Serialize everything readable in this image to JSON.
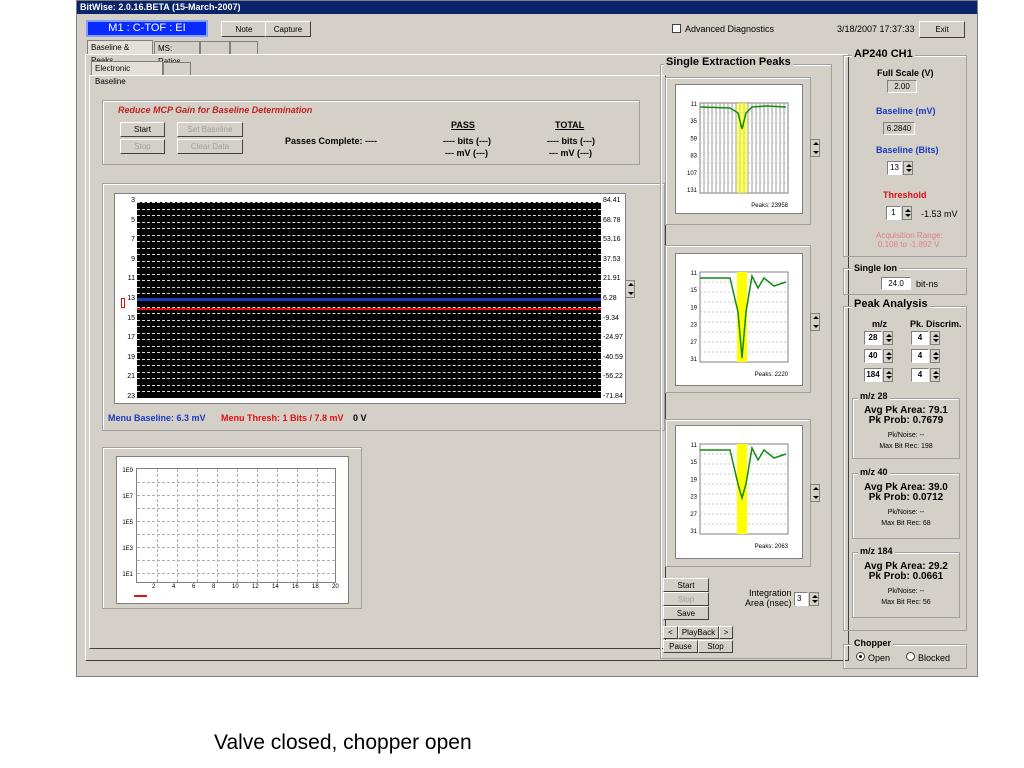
{
  "window_title": "BitWise: 2.0.16.BETA (15-March-2007)",
  "mode_label": "M1 : C-TOF : EI",
  "toolbar": {
    "note": "Note",
    "capture": "Capture",
    "advanced_diagnostics": "Advanced Diagnostics",
    "datetime": "3/18/2007 17:37:33",
    "exit": "Exit"
  },
  "tabs": [
    "Baseline & Peaks",
    "MS: Ratios",
    "",
    ""
  ],
  "subtabs": [
    "Electronic Baseline",
    ""
  ],
  "baseline": {
    "warning": "Reduce MCP Gain for Baseline Determination",
    "start": "Start",
    "set_baseline": "Set Baseline",
    "stop": "Stop",
    "clear_data": "Clear Data",
    "passes_complete": "Passes Complete: ----",
    "pass_header": "PASS",
    "total_header": "TOTAL",
    "pass_bits": "---- bits (---)",
    "pass_mv": "--- mV (---)",
    "total_bits": "---- bits (---)",
    "total_mv": "--- mV (---)"
  },
  "main_chart": {
    "left_ticks": [
      "3",
      "5",
      "7",
      "9",
      "11",
      "13",
      "15",
      "17",
      "19",
      "21",
      "23"
    ],
    "right_ticks": [
      "84.41",
      "68.78",
      "53.16",
      "37.53",
      "21.91",
      "6.28",
      "-9.34",
      "-24.97",
      "-40.59",
      "-56.22",
      "-71.84"
    ],
    "menu_baseline": "Menu Baseline: 6.3 mV",
    "menu_thresh": "Menu Thresh: 1 Bits / 7.8 mV",
    "zero_v": "0 V",
    "colors": {
      "baseline": "#1a3bc0",
      "threshold": "#e01010"
    }
  },
  "hist_chart": {
    "y_ticks": [
      "1E9",
      "1E7",
      "1E5",
      "1E3",
      "1E1"
    ],
    "x_ticks": [
      "2",
      "4",
      "6",
      "8",
      "10",
      "12",
      "14",
      "16",
      "18",
      "20"
    ]
  },
  "peaks": {
    "title": "Single Extraction Peaks",
    "panels": [
      {
        "y_ticks": [
          "11",
          "35",
          "59",
          "83",
          "107",
          "131"
        ],
        "label": "Peaks: 23958"
      },
      {
        "y_ticks": [
          "11",
          "15",
          "19",
          "23",
          "27",
          "31"
        ],
        "label": "Peaks: 2220"
      },
      {
        "y_ticks": [
          "11",
          "15",
          "19",
          "23",
          "27",
          "31"
        ],
        "label": "Peaks: 2063"
      }
    ],
    "start": "Start",
    "stop": "Stop",
    "save": "Save",
    "prev": "<",
    "playback": "PlayBack",
    "next": ">",
    "pause": "Pause",
    "stop2": "Stop",
    "integration_label_1": "Integration",
    "integration_label_2": "Area (nsec)",
    "integration_value": "3"
  },
  "ap240": {
    "title": "AP240 CH1",
    "full_scale_label": "Full Scale (V)",
    "full_scale_value": "2.00",
    "baseline_mv_label": "Baseline (mV)",
    "baseline_mv_value": "6.2840",
    "baseline_bits_label": "Baseline (Bits)",
    "baseline_bits_value": "13",
    "threshold_label": "Threshold",
    "threshold_value": "1",
    "threshold_mv": "-1.53 mV",
    "acq_range_1": "Acquisition Range:",
    "acq_range_2": "0.108 to -1.892 V"
  },
  "single_ion": {
    "title": "Single Ion",
    "value": "24.0",
    "unit": "bit-ns"
  },
  "peak_analysis": {
    "title": "Peak Analysis",
    "mz_header": "m/z",
    "discrim_header": "Pk. Discrim.",
    "rows": [
      {
        "mz": "28",
        "disc": "4"
      },
      {
        "mz": "40",
        "disc": "4"
      },
      {
        "mz": "184",
        "disc": "4"
      }
    ],
    "groups": [
      {
        "title": "m/z 28",
        "area": "Avg Pk Area: 79.1",
        "prob": "Pk Prob: 0.7679",
        "noise": "Pk/Noise: --",
        "maxbit": "Max Bit Rec: 198"
      },
      {
        "title": "m/z 40",
        "area": "Avg Pk Area: 39.0",
        "prob": "Pk Prob: 0.0712",
        "noise": "Pk/Noise: --",
        "maxbit": "Max Bit Rec: 68"
      },
      {
        "title": "m/z 184",
        "area": "Avg Pk Area: 29.2",
        "prob": "Pk Prob: 0.0661",
        "noise": "Pk/Noise: --",
        "maxbit": "Max Bit Rec: 56"
      }
    ]
  },
  "chopper": {
    "title": "Chopper",
    "open": "Open",
    "blocked": "Blocked",
    "selected": "Open"
  },
  "caption": "Valve closed, chopper open"
}
